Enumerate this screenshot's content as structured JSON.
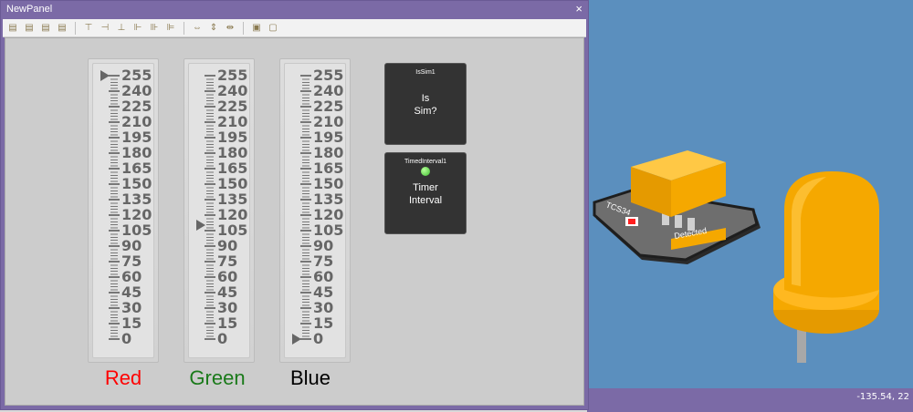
{
  "window": {
    "title": "NewPanel",
    "close_glyph": "×"
  },
  "toolbar": {
    "icons": [
      "align-left-icon",
      "align-center-icon",
      "align-right-icon",
      "distribute-icon",
      "align-top-icon",
      "align-middle-icon",
      "align-bottom-icon",
      "align-baseline-icon",
      "size-width-icon",
      "size-height-icon",
      "spacing-h-icon",
      "spacing-v-icon",
      "bring-front-icon",
      "send-back-icon"
    ]
  },
  "sliders": [
    {
      "label": "Red",
      "color": "#ff0000",
      "value": 255
    },
    {
      "label": "Green",
      "color": "#1a7a1a",
      "value": 110
    },
    {
      "label": "Blue",
      "color": "#000000",
      "value": 0
    }
  ],
  "scale": {
    "ticks": [
      "255",
      "240",
      "225",
      "210",
      "195",
      "180",
      "165",
      "150",
      "135",
      "120",
      "105",
      "90",
      "75",
      "60",
      "45",
      "30",
      "15",
      "0"
    ],
    "min": 0,
    "max": 255
  },
  "cards": [
    {
      "name": "IsSim1",
      "text_line1": "Is",
      "text_line2": "Sim?"
    },
    {
      "name": "TimedInterval1",
      "text_line1": "Timer",
      "text_line2": "Interval",
      "led_color": "#4fcf3f"
    }
  ],
  "viewport": {
    "board_label": "TCS34",
    "detected_label": "Detected",
    "background": "#5b8fbe",
    "model_color": "#f5a800"
  },
  "status": {
    "coords": "-135.54, 22"
  }
}
